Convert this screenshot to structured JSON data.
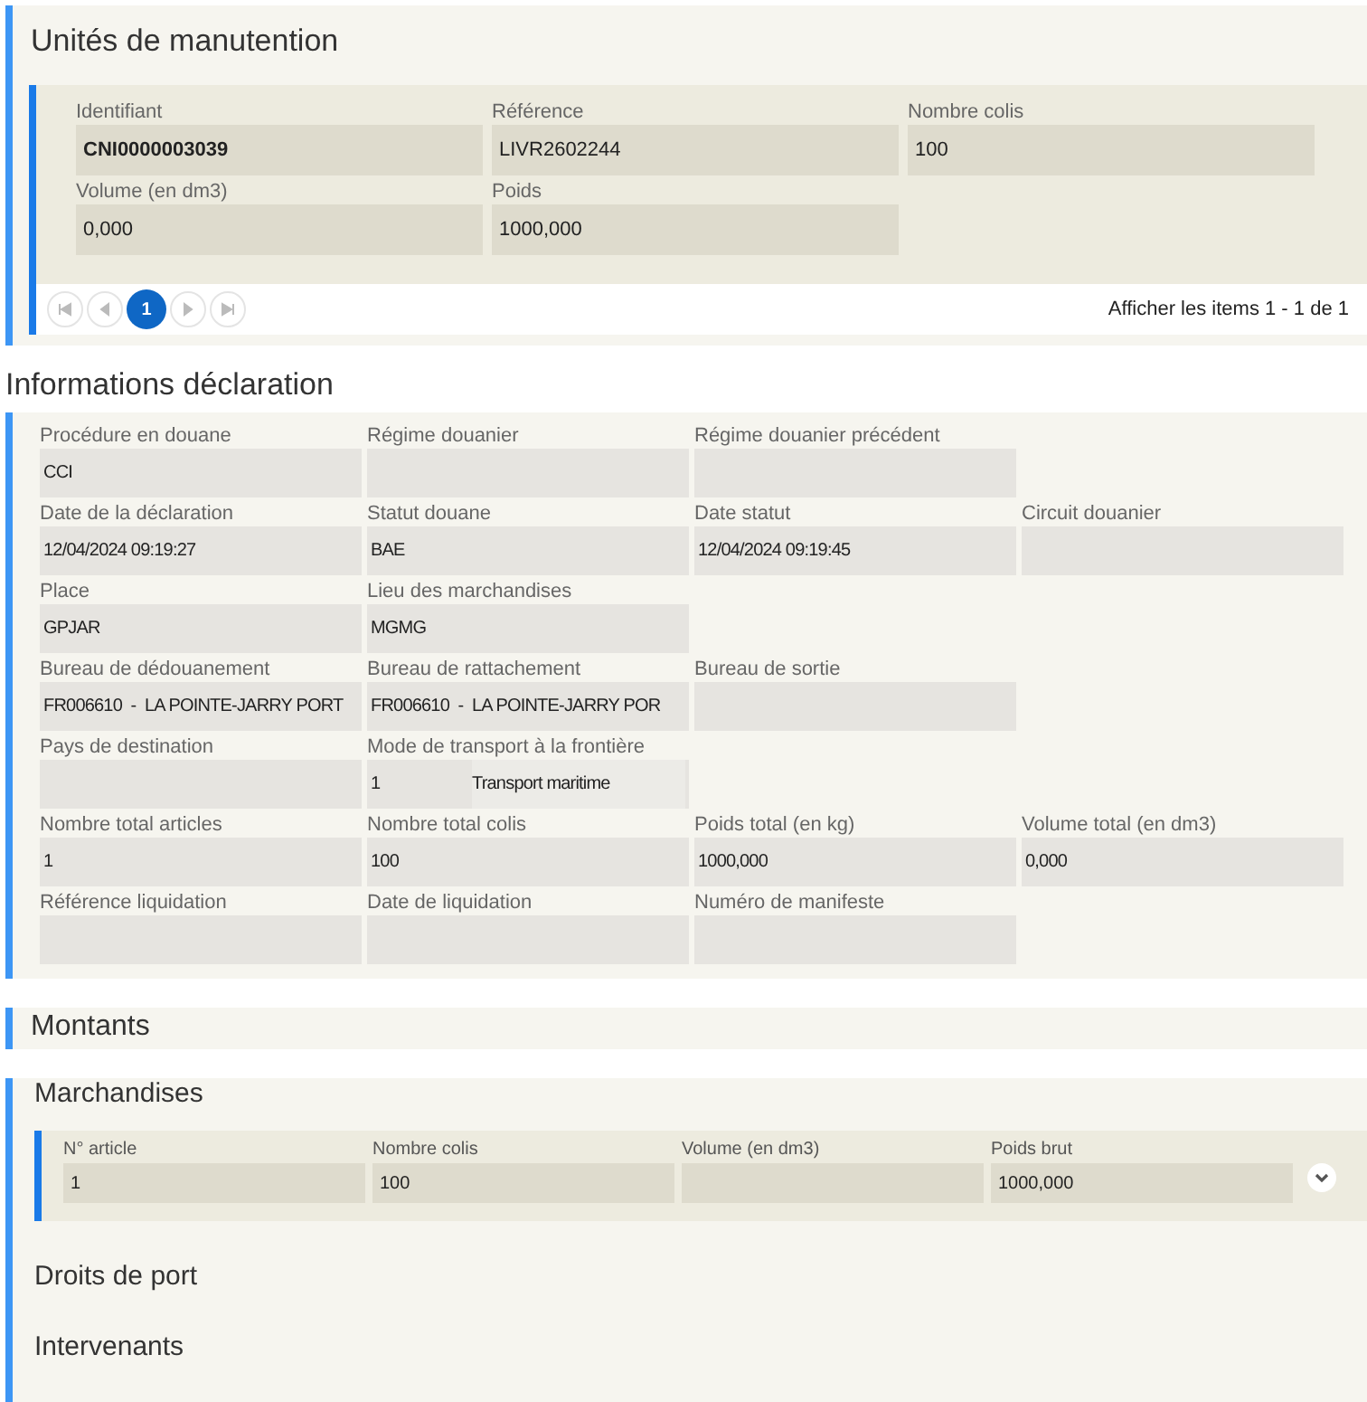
{
  "handling_units": {
    "title": "Unités de manutention",
    "fields": [
      {
        "label": "Identifiant",
        "value": "CNI0000003039",
        "bold": true
      },
      {
        "label": "Référence",
        "value": "LIVR2602244",
        "bold": false
      },
      {
        "label": "Nombre colis",
        "value": "100",
        "bold": false
      },
      {
        "label": "Volume (en dm3)",
        "value": "0,000",
        "bold": false
      },
      {
        "label": "Poids",
        "value": "1000,000",
        "bold": false
      }
    ],
    "pager": {
      "pages": [
        {
          "label": "1",
          "selected": true
        }
      ],
      "summary": "Afficher les items 1 - 1 de 1"
    }
  },
  "declaration": {
    "title": "Informations déclaration",
    "rows": [
      [
        {
          "label": "Procédure en douane",
          "value": "CCI"
        },
        {
          "label": "Régime douanier"
        },
        {
          "label": "Régime douanier précédent"
        }
      ],
      [
        {
          "label": "Date de la déclaration",
          "value": "12/04/2024 09:19:27"
        },
        {
          "label": "Statut douane",
          "value": "BAE"
        },
        {
          "label": "Date statut",
          "value": "12/04/2024 09:19:45"
        },
        {
          "label": "Circuit douanier"
        }
      ],
      [
        {
          "label": "Place",
          "value": "GPJAR"
        },
        {
          "label": "Lieu des marchandises",
          "value": "MGMG"
        }
      ],
      [
        {
          "label": "Bureau de dédouanement",
          "value": "FR006610  -  LA POINTE-JARRY PORT"
        },
        {
          "label": "Bureau de rattachement",
          "value": "FR006610  -  LA POINTE-JARRY POR"
        },
        {
          "label": "Bureau de sortie"
        }
      ],
      [
        {
          "label": "Pays de destination"
        },
        {
          "label": "Mode de transport à la frontière",
          "value": "1",
          "value_2": "Transport maritime"
        }
      ],
      [
        {
          "label": "Nombre total articles",
          "value": "1"
        },
        {
          "label": "Nombre total colis",
          "value": "100"
        },
        {
          "label": "Poids total (en kg)",
          "value": "1000,000"
        },
        {
          "label": "Volume total (en dm3)",
          "value": "0,000"
        }
      ],
      [
        {
          "label": "Référence liquidation"
        },
        {
          "label": "Date de liquidation"
        },
        {
          "label": "Numéro de manifeste"
        }
      ]
    ]
  },
  "amounts": {
    "title": "Montants"
  },
  "goods": {
    "title": "Marchandises",
    "items": [
      {
        "fields": [
          {
            "label": "N° article",
            "value": "1"
          },
          {
            "label": "Nombre colis",
            "value": "100"
          },
          {
            "label": "Volume (en dm3)"
          },
          {
            "label": "Poids brut",
            "value": "1000,000"
          }
        ],
        "expanded": false
      }
    ],
    "subsections": [
      "Droits de port",
      "Intervenants"
    ]
  }
}
